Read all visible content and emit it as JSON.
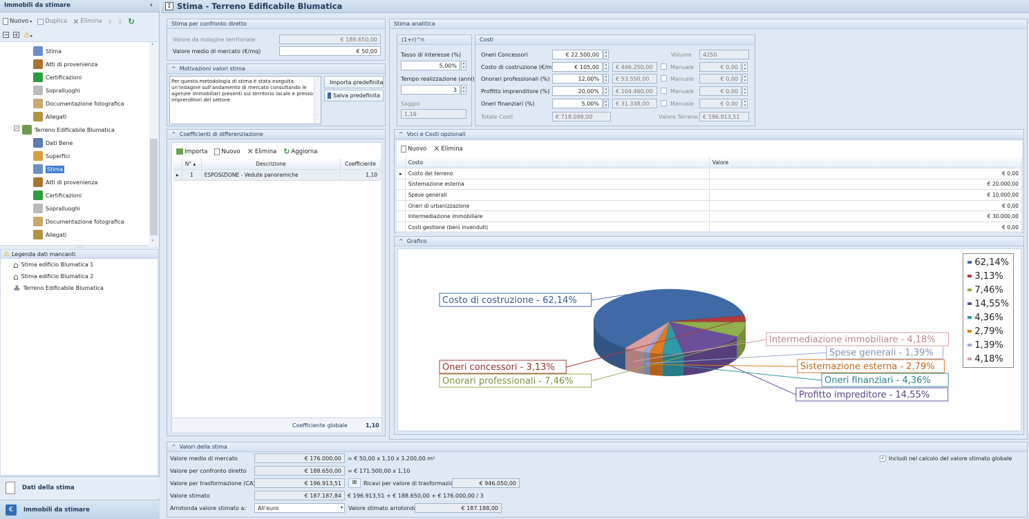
{
  "sidebar": {
    "title": "Immobili da stimare",
    "collapse": "‹",
    "toolbar": {
      "nuovo": "Nuovo",
      "duplica": "Duplica",
      "elimina": "Elimina"
    },
    "tree": [
      {
        "label": "Stima",
        "icon": "sigma-icon",
        "color": "#6a8fc7"
      },
      {
        "label": "Atti di provenienza",
        "icon": "stamp-icon",
        "color": "#a8742e"
      },
      {
        "label": "Certificazioni",
        "icon": "certificate-icon",
        "color": "#2d9c3c"
      },
      {
        "label": "Sopralluoghi",
        "icon": "visit-icon",
        "color": "#bbbbbb"
      },
      {
        "label": "Documentazione fotografica",
        "icon": "photo-icon",
        "color": "#c9a86a"
      },
      {
        "label": "Allegati",
        "icon": "attachment-icon",
        "color": "#b39440"
      },
      {
        "label": "Terreno Edificabile Blumatica",
        "icon": "land-icon",
        "color": "#6f9a4e"
      },
      {
        "label": "Dati Bene",
        "icon": "property-icon",
        "color": "#5b7cb5"
      },
      {
        "label": "Superfici",
        "icon": "area-icon",
        "color": "#d3a040"
      },
      {
        "label": "Stima",
        "icon": "sigma-icon",
        "color": "#6a8fc7"
      },
      {
        "label": "Atti di provenienza",
        "icon": "stamp-icon",
        "color": "#a8742e"
      },
      {
        "label": "Certificazioni",
        "icon": "certificate-icon",
        "color": "#2d9c3c"
      },
      {
        "label": "Sopralluoghi",
        "icon": "visit-icon",
        "color": "#bbbbbb"
      },
      {
        "label": "Documentazione fotografica",
        "icon": "photo-icon",
        "color": "#c9a86a"
      },
      {
        "label": "Allegati",
        "icon": "attachment-icon",
        "color": "#b39440"
      }
    ],
    "legend_title": "Legenda dati mancanti",
    "legend_items": [
      "Stima edificio Blumatica 1",
      "Stima edificio Blumatica 2",
      "Terreno Edificabile Blumatica"
    ],
    "nav": {
      "dati": "Dati della stima",
      "immobili": "Immobili da stimare"
    }
  },
  "header": {
    "title": "Stima - Terreno Edificabile Blumatica"
  },
  "confronto": {
    "title": "Stima per confronto diretto",
    "indagine_label": "Valore da indagine territoriale",
    "indagine_value": "€ 188.650,00",
    "medio_label": "Valore medio di mercato (€/mq)",
    "medio_value": "€ 50,00"
  },
  "motivazioni": {
    "title": "Motivazioni valori stima",
    "text": "Per questa metodologia di stima è stata eseguita un'indagine sull'andamento di mercato consultando le agenzie immobiliari presenti sul territorio locale e presso imprenditori del settore",
    "importa": "Importa predefinita",
    "salva": "Salva predefinita"
  },
  "coefficienti": {
    "title": "Coefficienti di differenziazione",
    "toolbar": {
      "importa": "Importa",
      "nuovo": "Nuovo",
      "elimina": "Elimina",
      "aggiorna": "Aggiorna"
    },
    "cols": [
      "N°",
      "Descrizione",
      "Coefficiente"
    ],
    "rows": [
      {
        "n": "1",
        "desc": "ESPOSIZIONE - Vedute panoramiche",
        "coef": "1,10"
      }
    ],
    "globale_label": "Coefficiente globale",
    "globale_value": "1,10"
  },
  "analitica": {
    "title": "Stima analitica",
    "formula_title": "(1+r)^n",
    "tasso_label": "Tasso di interesse (%)",
    "tasso_value": "5,00%",
    "tempo_label": "Tempo realizzazione (anni)",
    "tempo_value": "3",
    "saggio_label": "Saggio",
    "saggio_value": "1,16",
    "costi_title": "Costi",
    "costi": [
      {
        "label": "Oneri Concessori",
        "value": "€ 22.500,00",
        "calc": "",
        "side_label": "Volume",
        "side_value": "4250"
      },
      {
        "label": "Costo di costruzione (€/mc)",
        "value": "€ 105,00",
        "calc": "€ 446.250,00",
        "side_label": "Manuale",
        "side_value": "€ 0,00"
      },
      {
        "label": "Onorari professionali (%)",
        "value": "12,00%",
        "calc": "€ 53.550,00",
        "side_label": "Manuale",
        "side_value": "€ 0,00"
      },
      {
        "label": "Profitto imprenditore (%)",
        "value": "20,00%",
        "calc": "€ 104.460,00",
        "side_label": "Manuale",
        "side_value": "€ 0,00"
      },
      {
        "label": "Oneri finanziari (%)",
        "value": "5,00%",
        "calc": "€ 31.338,00",
        "side_label": "Manuale",
        "side_value": "€ 0,00"
      }
    ],
    "totale_label": "Totale Costi",
    "totale_value": "€ 718.098,00",
    "terreno_label": "Valore Terreno",
    "terreno_value": "€ 196.913,51"
  },
  "voci": {
    "title": "Voci e Costi opzionali",
    "toolbar": {
      "nuovo": "Nuovo",
      "elimina": "Elimina"
    },
    "cols": [
      "Costo",
      "Valore"
    ],
    "rows": [
      {
        "costo": "Costo del terreno",
        "valore": "€ 0,00"
      },
      {
        "costo": "Sistemazione esterna",
        "valore": "€ 20.000,00"
      },
      {
        "costo": "Spese generali",
        "valore": "€ 10.000,00"
      },
      {
        "costo": "Oneri di urbanizzazione",
        "valore": "€ 0,00"
      },
      {
        "costo": "Intermediazione immobiliare",
        "valore": "€ 30.000,00"
      },
      {
        "costo": "Costi gestione (beni invenduti)",
        "valore": "€ 0,00"
      }
    ]
  },
  "grafico": {
    "title": "Grafico"
  },
  "chart_data": {
    "type": "pie",
    "slices": [
      {
        "label": "Costo di costruzione - 62,14%",
        "legend": "62,14%",
        "value": 62.14,
        "color": "#3f6aa6"
      },
      {
        "label": "Oneri concessori - 3,13%",
        "legend": "3,13%",
        "value": 3.13,
        "color": "#b03a3a"
      },
      {
        "label": "Onorari professionali - 7,46%",
        "legend": "7,46%",
        "value": 7.46,
        "color": "#8fb04a"
      },
      {
        "label": "Profitto impreditore - 14,55%",
        "legend": "14,55%",
        "value": 14.55,
        "color": "#6b4f99"
      },
      {
        "label": "Oneri finanziari - 4,36%",
        "legend": "4,36%",
        "value": 4.36,
        "color": "#2f9aa8"
      },
      {
        "label": "Sistemazione esterna - 2,79%",
        "legend": "2,79%",
        "value": 2.79,
        "color": "#e07a22"
      },
      {
        "label": "Spese generali - 1,39%",
        "legend": "1,39%",
        "value": 1.39,
        "color": "#98a8d8"
      },
      {
        "label": "Intermediazione immobiliare - 4,18%",
        "legend": "4,18%",
        "value": 4.18,
        "color": "#d9a0a0"
      }
    ],
    "legend_placement": "top-right"
  },
  "valori": {
    "title": "Valori della stima",
    "rows": [
      {
        "label": "Valore medio di mercato",
        "value": "€ 176.000,00",
        "formula": "= € 50,00 x 1,10 x 3.200,00 m²"
      },
      {
        "label": "Valore per confronto diretto",
        "value": "€ 188.650,00",
        "formula": "= € 171.500,00 x 1,10"
      },
      {
        "label": "Valore per trasformazione (CA)",
        "value": "€ 196.913,51",
        "formula": ""
      },
      {
        "label": "Valore stimato",
        "value": "€ 187.187,84",
        "formula": "€ 196.913,51 + € 188.650,00 + € 176.000,00 / 3"
      }
    ],
    "ricavi_label": "Ricavi per valore di trasformazione",
    "ricavi_value": "€ 946.050,00",
    "arrotonda_label": "Arrotonda valore stimato a:",
    "arrotonda_value": "All'euro",
    "arrotondato_label": "Valore stimato arrotondato",
    "arrotondato_value": "€ 187.188,00",
    "includi_label": "Includi nel calcolo del valore stimato globale"
  }
}
